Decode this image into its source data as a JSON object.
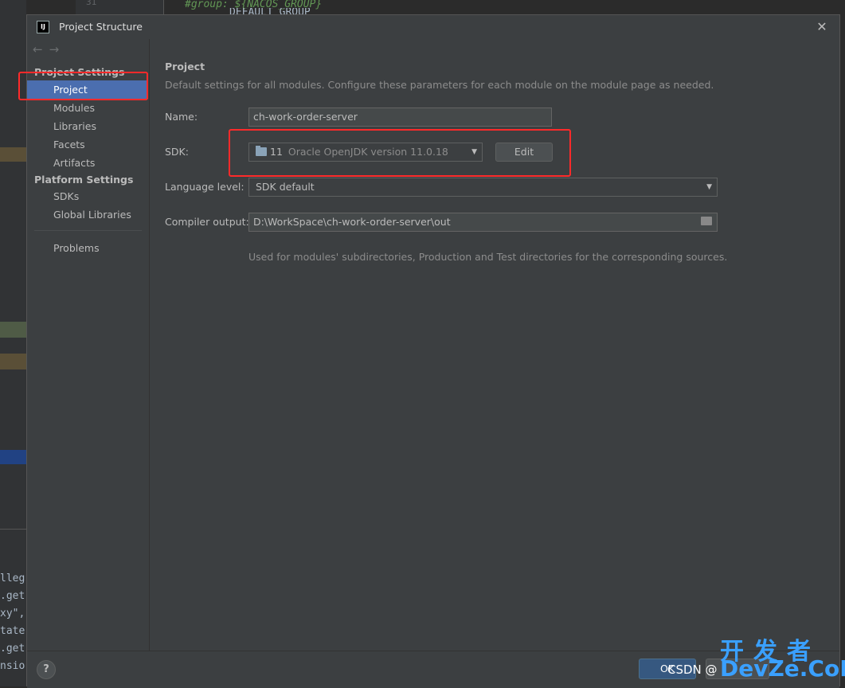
{
  "window": {
    "title": "Project Structure"
  },
  "nav": {
    "back": "←",
    "forward": "→"
  },
  "sidebar": {
    "project_settings_header": "Project Settings",
    "project_settings_items": [
      {
        "label": "Project"
      },
      {
        "label": "Modules"
      },
      {
        "label": "Libraries"
      },
      {
        "label": "Facets"
      },
      {
        "label": "Artifacts"
      }
    ],
    "platform_settings_header": "Platform Settings",
    "platform_settings_items": [
      {
        "label": "SDKs"
      },
      {
        "label": "Global Libraries"
      }
    ],
    "problems_label": "Problems"
  },
  "content": {
    "title": "Project",
    "description": "Default settings for all modules. Configure these parameters for each module on the module page as needed.",
    "name_label": "Name:",
    "name_value": "ch-work-order-server",
    "sdk_label": "SDK:",
    "sdk_version": "11",
    "sdk_name": "Oracle OpenJDK version 11.0.18",
    "edit_label": "Edit",
    "language_level_label": "Language level:",
    "language_level_value": "SDK default",
    "compiler_output_label": "Compiler output:",
    "compiler_output_value": "D:\\WorkSpace\\ch-work-order-server\\out",
    "compiler_output_hint": "Used for modules' subdirectories, Production and Test directories for the corresponding sources."
  },
  "footer": {
    "help": "?",
    "ok": "OK"
  },
  "background": {
    "line_number": "31",
    "code_top": "#group: ${NACOS_GROUP}",
    "code_top2": "DEFAULT_GROUP",
    "code_bottom": [
      "lleg",
      ".get",
      "xy\",",
      "tate",
      ".get",
      "nsio"
    ]
  },
  "watermark": {
    "csdn": "CSDN @",
    "cn": "开发者",
    "en": "DevZe.CoM"
  },
  "colors": {
    "selection": "#4b6eaf",
    "highlight_box": "#ff2a2a",
    "dialog_bg": "#3c3f41"
  }
}
